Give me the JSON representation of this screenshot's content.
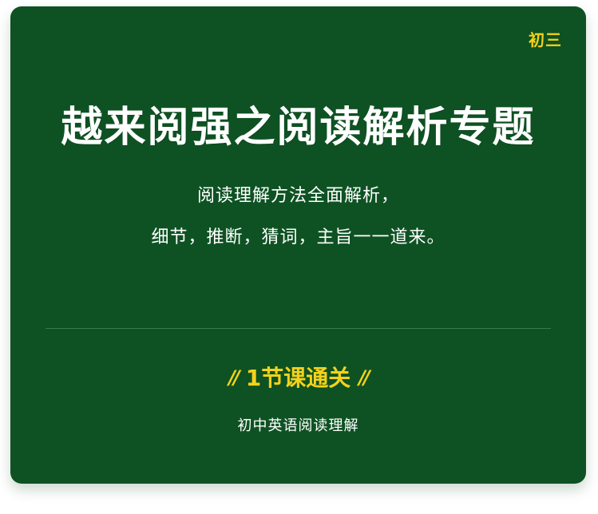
{
  "card": {
    "grade": "初三",
    "title": "越来阅强之阅读解析专题",
    "subtitle_line1": "阅读理解方法全面解析，",
    "subtitle_line2": "细节，推断，猜词，主旨一一道来。",
    "tagline": "1节课通关",
    "tagline_mark_left": "//",
    "tagline_mark_right": "//",
    "course_name": "初中英语阅读理解"
  },
  "colors": {
    "background": "#0e5223",
    "accent": "#f5d21a",
    "text": "#ffffff"
  }
}
